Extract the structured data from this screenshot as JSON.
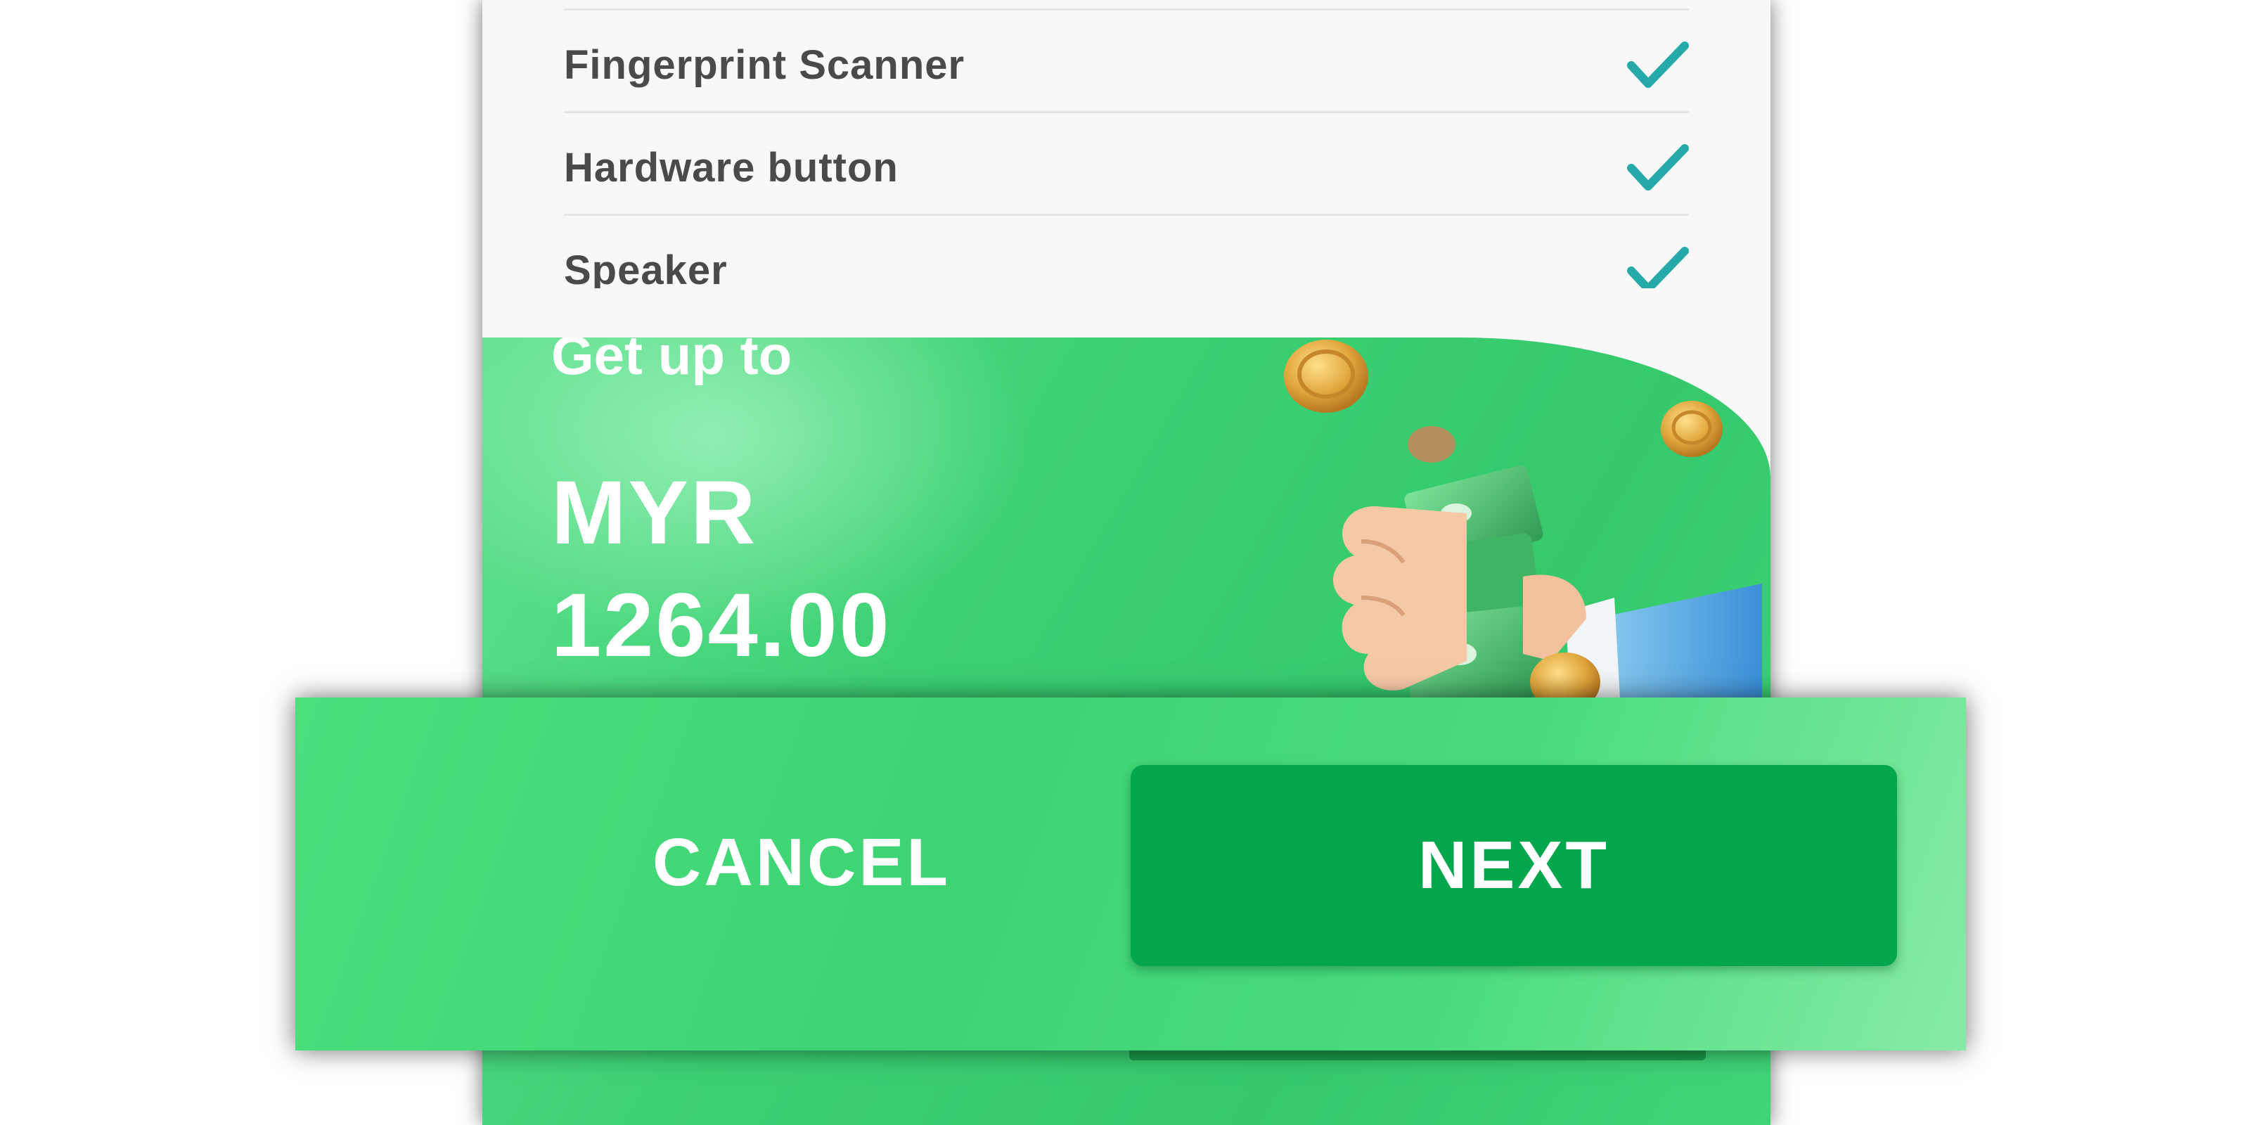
{
  "checklist": {
    "items": [
      {
        "label": "Fingerprint Scanner",
        "checked": true
      },
      {
        "label": "Hardware button",
        "checked": true
      },
      {
        "label": "Speaker",
        "checked": true
      }
    ]
  },
  "promo": {
    "headline": "Get up to",
    "currency": "MYR",
    "amount": "1264.00"
  },
  "actions": {
    "cancel_label": "CANCEL",
    "next_label": "NEXT"
  },
  "colors": {
    "accent_green": "#3cd173",
    "next_button": "#02a64c",
    "check_teal": "#26a9a9"
  }
}
